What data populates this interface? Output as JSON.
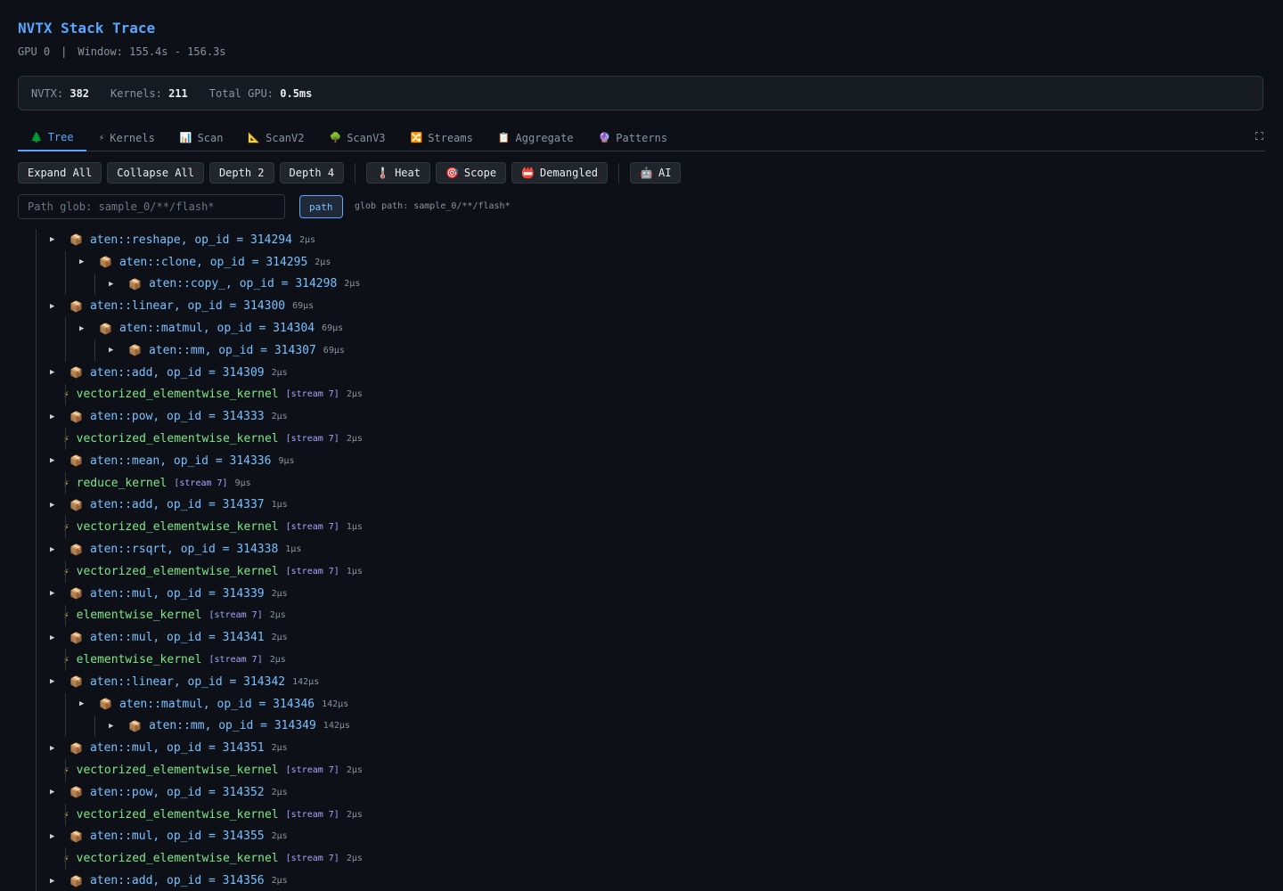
{
  "header": {
    "title": "NVTX Stack Trace",
    "gpu": "GPU 0",
    "window": "Window: 155.4s - 156.3s"
  },
  "stats": {
    "nvtx_label": "NVTX:",
    "nvtx_value": "382",
    "kernels_label": "Kernels:",
    "kernels_value": "211",
    "gpu_label": "Total GPU:",
    "gpu_value": "0.5ms"
  },
  "tabs": [
    {
      "icon": "🌲",
      "label": "Tree",
      "active": true
    },
    {
      "icon": "⚡",
      "label": "Kernels"
    },
    {
      "icon": "📊",
      "label": "Scan"
    },
    {
      "icon": "📐",
      "label": "ScanV2"
    },
    {
      "icon": "🌳",
      "label": "ScanV3"
    },
    {
      "icon": "🔀",
      "label": "Streams"
    },
    {
      "icon": "📋",
      "label": "Aggregate"
    },
    {
      "icon": "🔮",
      "label": "Patterns"
    }
  ],
  "toolbar": {
    "expand_all": "Expand All",
    "collapse_all": "Collapse All",
    "depth2": "Depth 2",
    "depth4": "Depth 4",
    "heat_icon": "🌡️",
    "heat": "Heat",
    "scope_icon": "🎯",
    "scope": "Scope",
    "demangled_icon": "📛",
    "demangled": "Demangled",
    "ai_icon": "🤖",
    "ai": "AI"
  },
  "glob": {
    "placeholder": "Path glob: sample_0/**/flash*",
    "button": "path",
    "hint": "glob path: sample_0/**/flash*"
  },
  "tree": [
    {
      "kind": "op",
      "depth": 0,
      "name": "aten::reshape, op_id = 314294",
      "dur": "2µs"
    },
    {
      "kind": "op",
      "depth": 1,
      "name": "aten::clone, op_id = 314295",
      "dur": "2µs"
    },
    {
      "kind": "op",
      "depth": 2,
      "name": "aten::copy_, op_id = 314298",
      "dur": "2µs"
    },
    {
      "kind": "op",
      "depth": 0,
      "name": "aten::linear, op_id = 314300",
      "dur": "69µs"
    },
    {
      "kind": "op",
      "depth": 1,
      "name": "aten::matmul, op_id = 314304",
      "dur": "69µs"
    },
    {
      "kind": "op",
      "depth": 2,
      "name": "aten::mm, op_id = 314307",
      "dur": "69µs"
    },
    {
      "kind": "op",
      "depth": 0,
      "name": "aten::add, op_id = 314309",
      "dur": "2µs"
    },
    {
      "kind": "kernel",
      "depth": 1,
      "name": "vectorized_elementwise_kernel",
      "stream": "[stream 7]",
      "dur": "2µs"
    },
    {
      "kind": "op",
      "depth": 0,
      "name": "aten::pow, op_id = 314333",
      "dur": "2µs"
    },
    {
      "kind": "kernel",
      "depth": 1,
      "name": "vectorized_elementwise_kernel",
      "stream": "[stream 7]",
      "dur": "2µs"
    },
    {
      "kind": "op",
      "depth": 0,
      "name": "aten::mean, op_id = 314336",
      "dur": "9µs"
    },
    {
      "kind": "kernel",
      "depth": 1,
      "name": "reduce_kernel",
      "stream": "[stream 7]",
      "dur": "9µs"
    },
    {
      "kind": "op",
      "depth": 0,
      "name": "aten::add, op_id = 314337",
      "dur": "1µs"
    },
    {
      "kind": "kernel",
      "depth": 1,
      "name": "vectorized_elementwise_kernel",
      "stream": "[stream 7]",
      "dur": "1µs"
    },
    {
      "kind": "op",
      "depth": 0,
      "name": "aten::rsqrt, op_id = 314338",
      "dur": "1µs"
    },
    {
      "kind": "kernel",
      "depth": 1,
      "name": "vectorized_elementwise_kernel",
      "stream": "[stream 7]",
      "dur": "1µs"
    },
    {
      "kind": "op",
      "depth": 0,
      "name": "aten::mul, op_id = 314339",
      "dur": "2µs"
    },
    {
      "kind": "kernel",
      "depth": 1,
      "name": "elementwise_kernel",
      "stream": "[stream 7]",
      "dur": "2µs"
    },
    {
      "kind": "op",
      "depth": 0,
      "name": "aten::mul, op_id = 314341",
      "dur": "2µs"
    },
    {
      "kind": "kernel",
      "depth": 1,
      "name": "elementwise_kernel",
      "stream": "[stream 7]",
      "dur": "2µs"
    },
    {
      "kind": "op",
      "depth": 0,
      "name": "aten::linear, op_id = 314342",
      "dur": "142µs"
    },
    {
      "kind": "op",
      "depth": 1,
      "name": "aten::matmul, op_id = 314346",
      "dur": "142µs"
    },
    {
      "kind": "op",
      "depth": 2,
      "name": "aten::mm, op_id = 314349",
      "dur": "142µs"
    },
    {
      "kind": "op",
      "depth": 0,
      "name": "aten::mul, op_id = 314351",
      "dur": "2µs"
    },
    {
      "kind": "kernel",
      "depth": 1,
      "name": "vectorized_elementwise_kernel",
      "stream": "[stream 7]",
      "dur": "2µs"
    },
    {
      "kind": "op",
      "depth": 0,
      "name": "aten::pow, op_id = 314352",
      "dur": "2µs"
    },
    {
      "kind": "kernel",
      "depth": 1,
      "name": "vectorized_elementwise_kernel",
      "stream": "[stream 7]",
      "dur": "2µs"
    },
    {
      "kind": "op",
      "depth": 0,
      "name": "aten::mul, op_id = 314355",
      "dur": "2µs"
    },
    {
      "kind": "kernel",
      "depth": 1,
      "name": "vectorized_elementwise_kernel",
      "stream": "[stream 7]",
      "dur": "2µs"
    },
    {
      "kind": "op",
      "depth": 0,
      "name": "aten::add, op_id = 314356",
      "dur": "2µs"
    }
  ]
}
